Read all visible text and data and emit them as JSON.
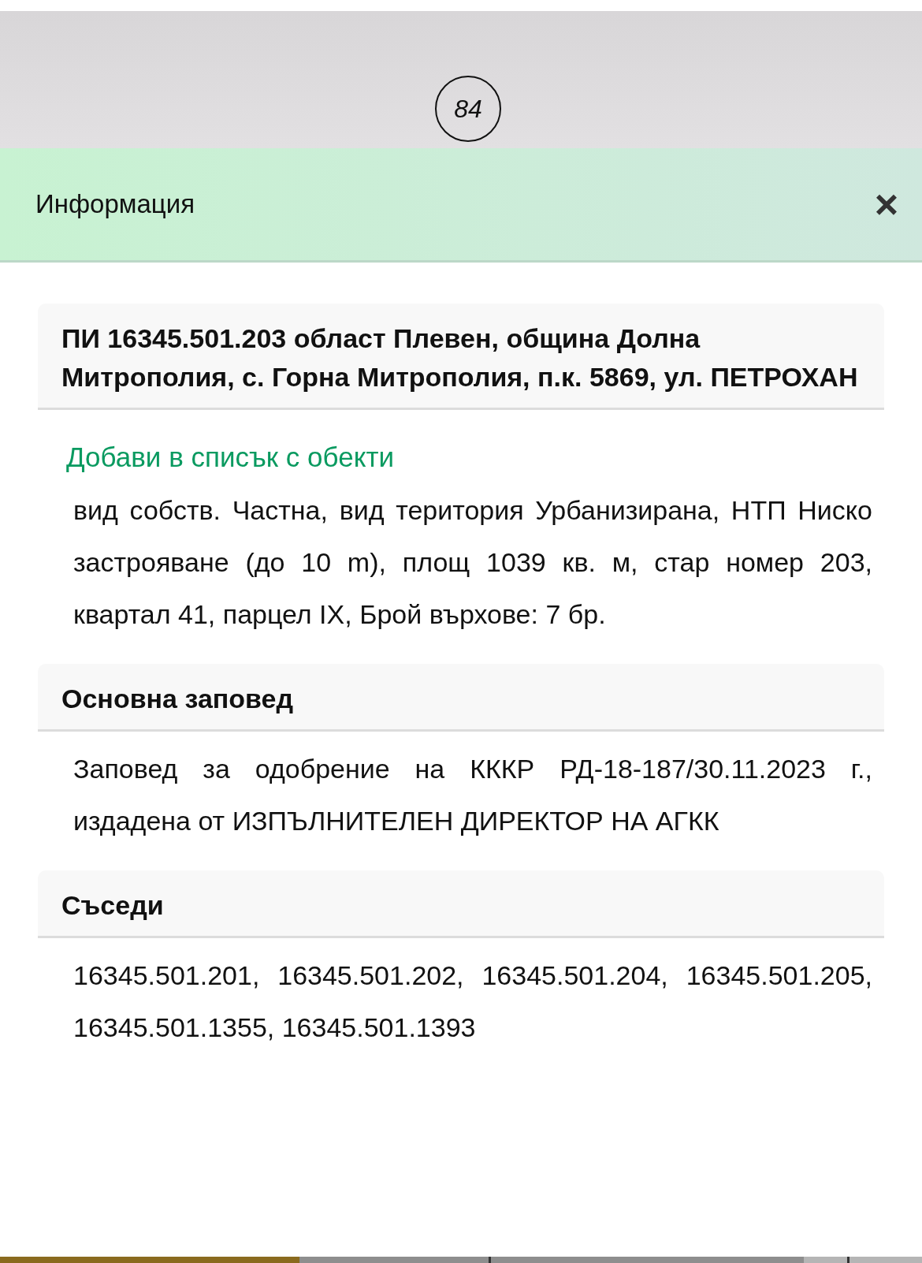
{
  "map": {
    "marker": "84"
  },
  "panel": {
    "title": "Информация",
    "close": "×"
  },
  "parcel": {
    "heading": "ПИ 16345.501.203 област Плевен, община Долна Митрополия, с. Горна Митрополия, п.к. 5869, ул. ПЕТРОХАН",
    "link": "Добави в списък с обекти",
    "text": "вид собств. Частна, вид територия Урбанизирана, НТП Ниско застрояване (до 10 m), площ 1039 кв. м, стар номер 203, квартал 41, парцел IX, Брой върхове: 7 бр."
  },
  "sections": [
    {
      "heading": "Основна заповед",
      "text": "Заповед за одобрение на КККР РД-18-187/30.11.2023 г., издадена от ИЗПЪЛНИТЕЛЕН ДИРЕКТОР НА АГКК"
    },
    {
      "heading": "Съседи",
      "text": "16345.501.201, 16345.501.202, 16345.501.204, 16345.501.205, 16345.501.1355, 16345.501.1393"
    }
  ]
}
